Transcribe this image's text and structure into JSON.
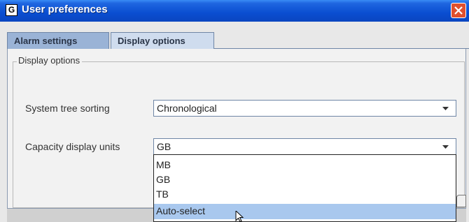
{
  "window": {
    "title": "User preferences",
    "app_icon_glyph": "G",
    "icons": {
      "app": "app-logo-icon",
      "close": "close-icon"
    },
    "colors": {
      "titlebar": "#0a4ed1",
      "close": "#e0502e",
      "selected_option": "#a9c8ee"
    }
  },
  "tabs": [
    {
      "label": "Alarm settings",
      "selected": false
    },
    {
      "label": "Display options",
      "selected": true
    }
  ],
  "group": {
    "title": "Display options"
  },
  "fields": {
    "sorting": {
      "label": "System tree sorting",
      "value": "Chronological"
    },
    "capacity": {
      "label": "Capacity display units",
      "value": "GB"
    }
  },
  "dropdown": {
    "options": [
      "MB",
      "GB",
      "TB",
      "Auto-select"
    ],
    "highlighted_index": 3
  }
}
